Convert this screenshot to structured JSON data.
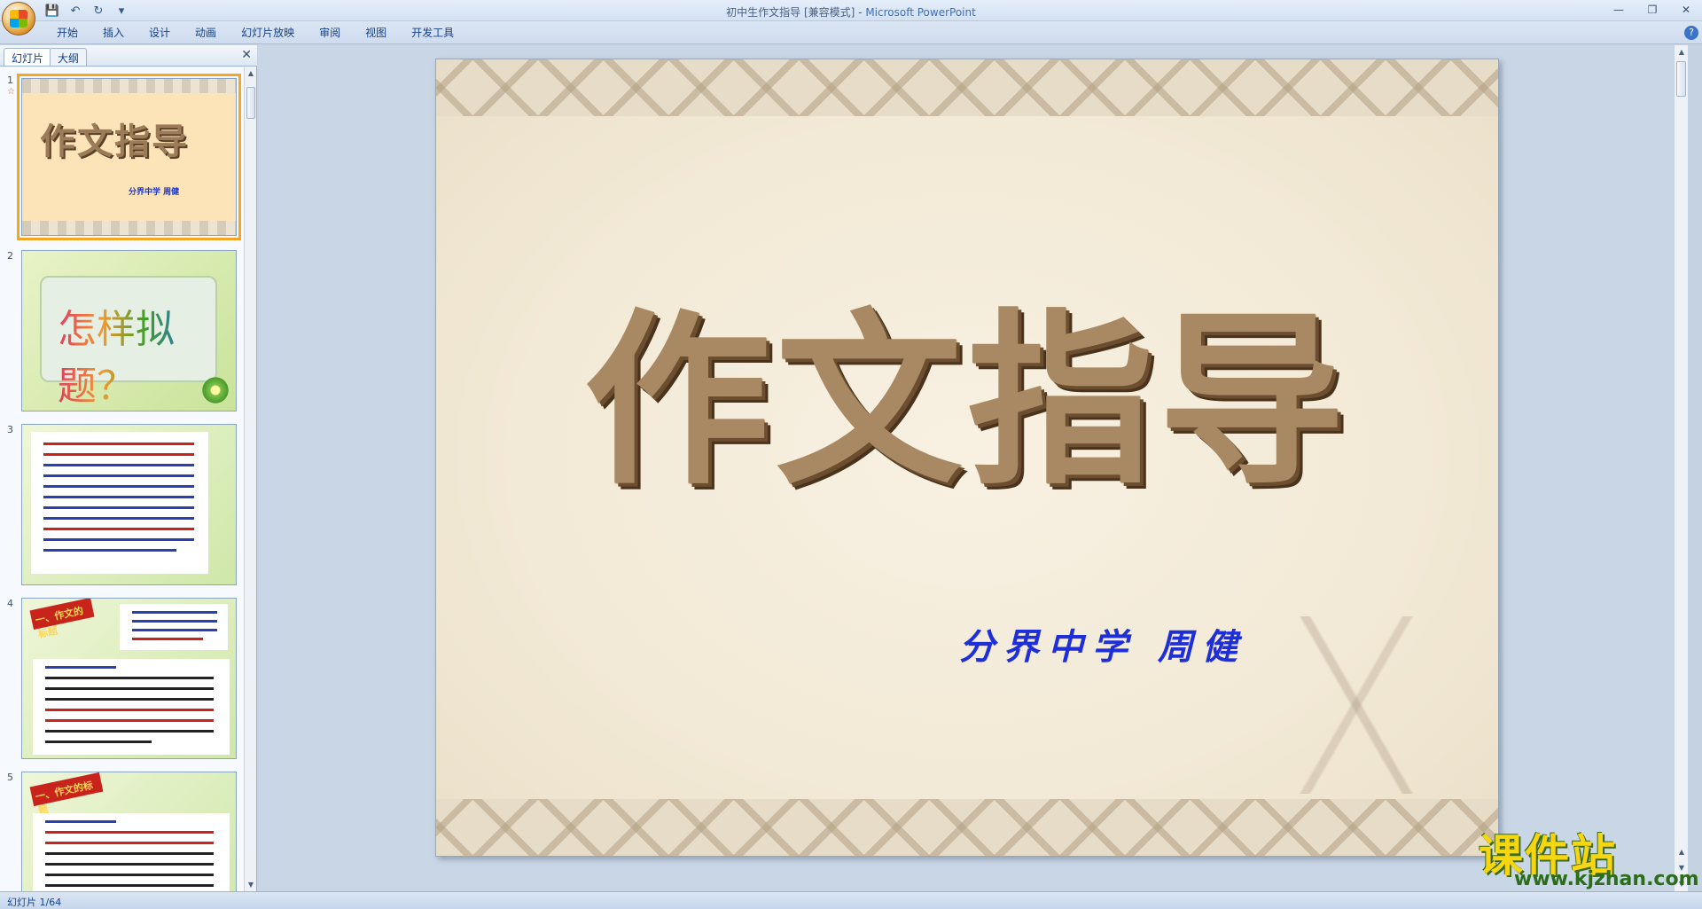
{
  "window": {
    "title": "初中生作文指导 [兼容模式] - ",
    "app_name": "Microsoft PowerPoint"
  },
  "ribbon": {
    "tabs": [
      "开始",
      "插入",
      "设计",
      "动画",
      "幻灯片放映",
      "审阅",
      "视图",
      "开发工具"
    ]
  },
  "left_panel": {
    "tabs": [
      "幻灯片",
      "大纲"
    ],
    "thumbnails": [
      {
        "number": "1",
        "title": "作文指导",
        "subtitle": "分界中学  周健"
      },
      {
        "number": "2",
        "title": "怎样拟题？"
      },
      {
        "number": "3"
      },
      {
        "number": "4",
        "heading": "一、作文的标题"
      },
      {
        "number": "5",
        "heading": "一、作文的标题"
      }
    ]
  },
  "slide": {
    "title": "作文指导",
    "subtitle": "分界中学 周健"
  },
  "watermark": {
    "text": "课件站",
    "url": "www.kjzhan.com"
  },
  "status_bar": {
    "slide_info": "幻灯片 1/64"
  }
}
